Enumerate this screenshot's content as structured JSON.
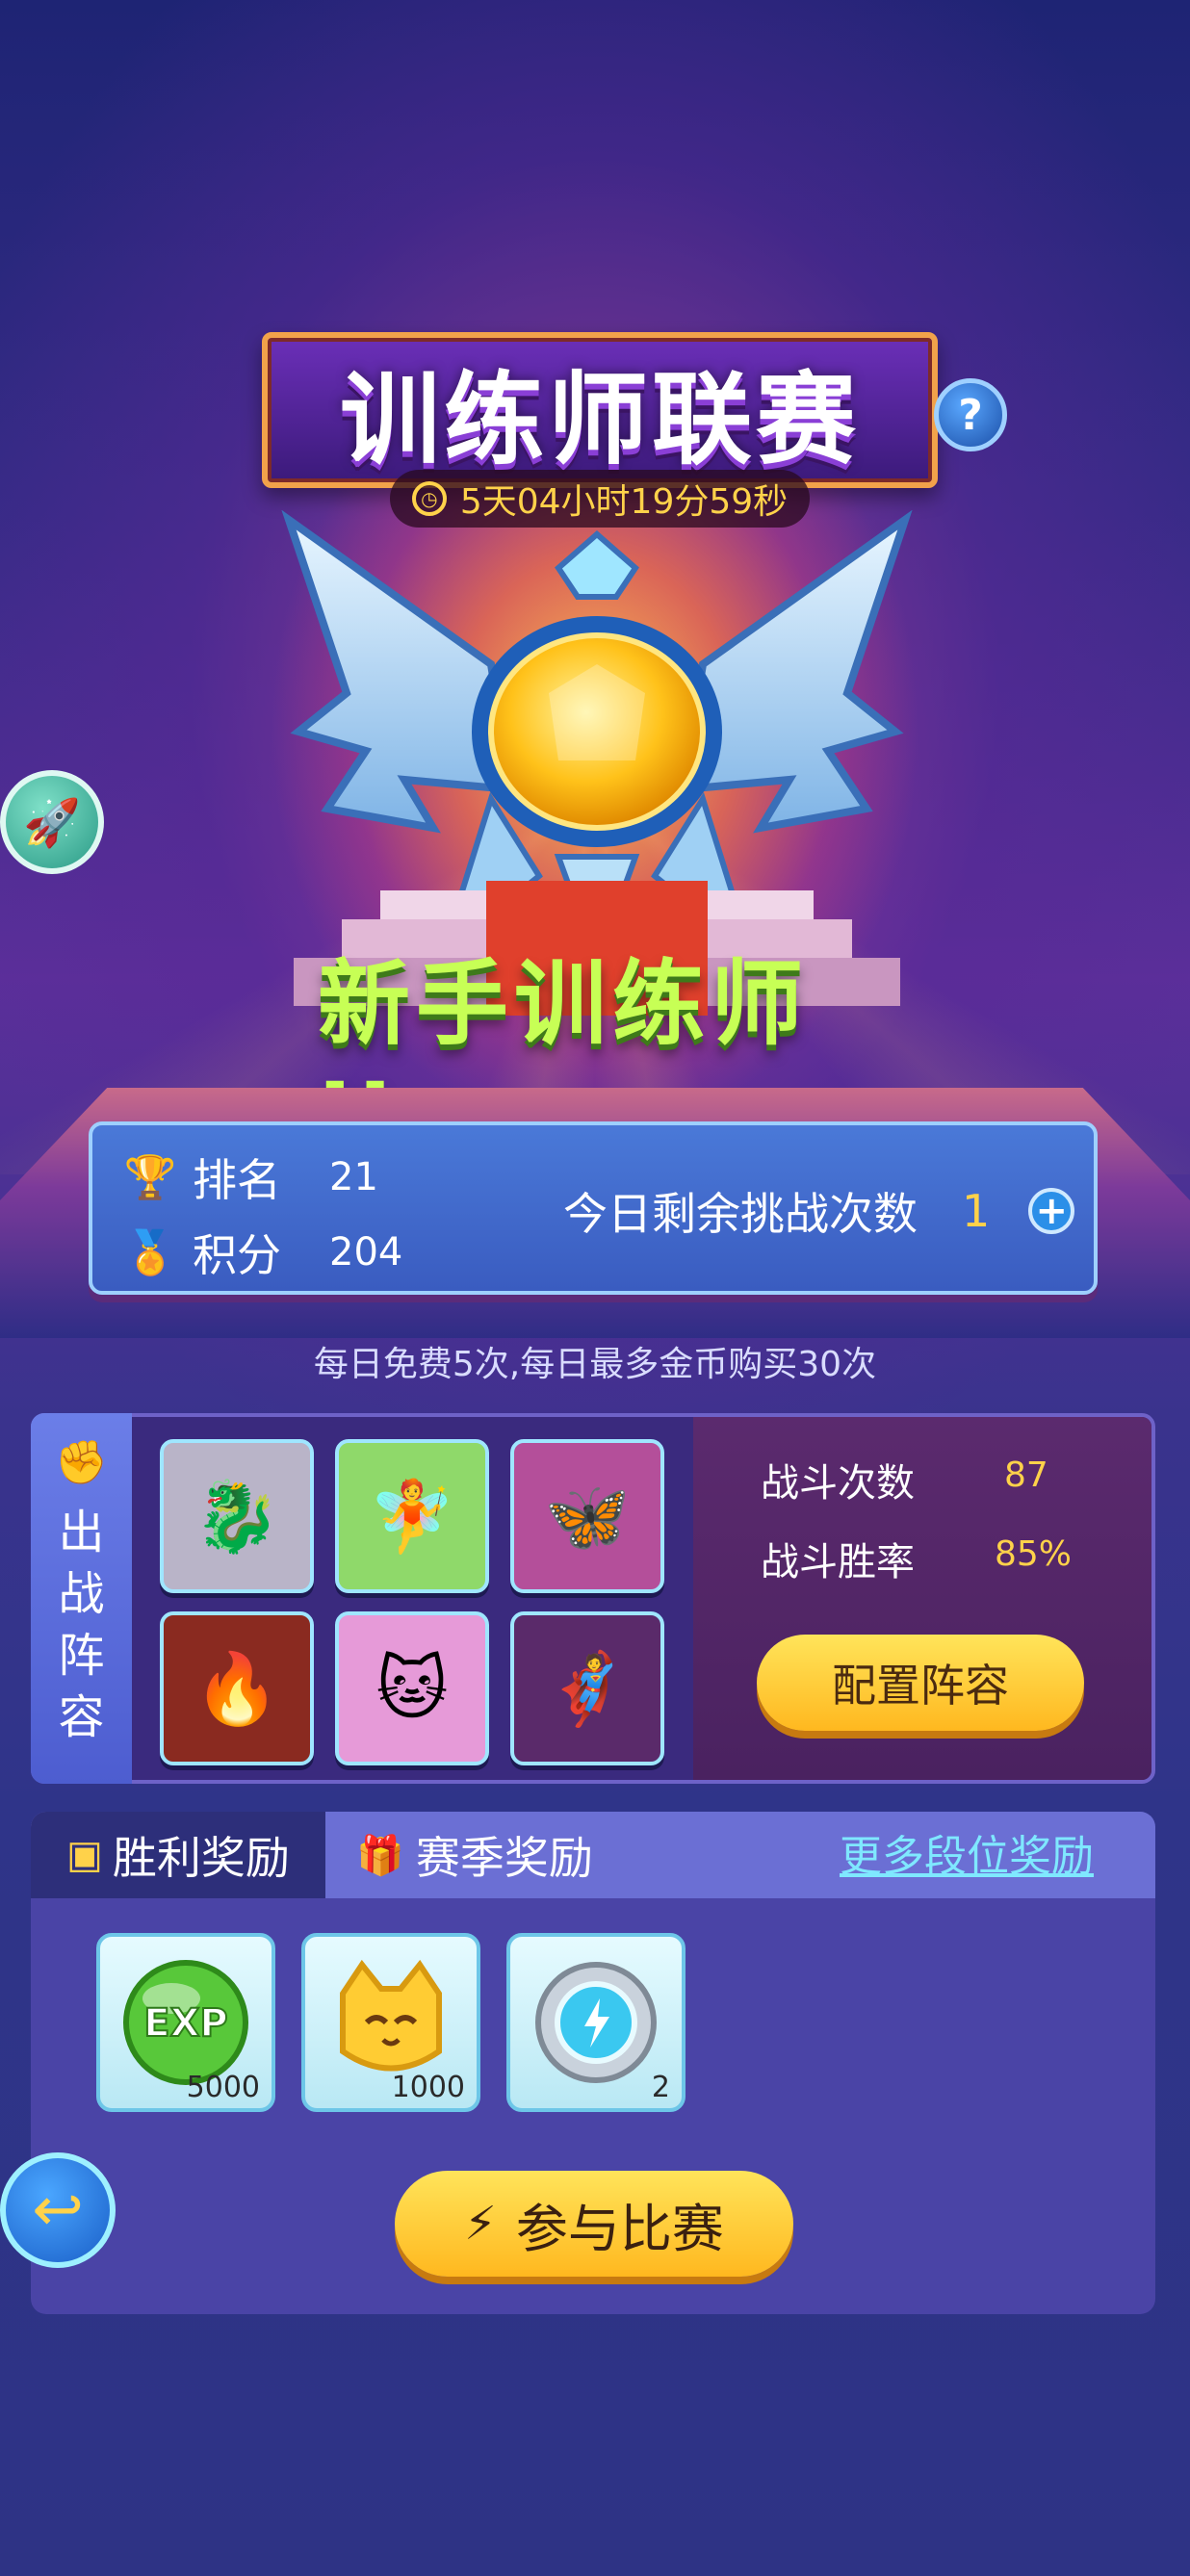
{
  "header": {
    "title": "训练师联赛",
    "timer": "5天04小时19分59秒",
    "help_label": "?"
  },
  "rank": {
    "name": "新手训练师 II"
  },
  "stats": {
    "rank_label": "排名",
    "rank_value": "21",
    "score_label": "积分",
    "score_value": "204",
    "remaining_label": "今日剩余挑战次数",
    "remaining_value": "1",
    "plus_label": "+",
    "note": "每日免费5次,每日最多金币购买30次"
  },
  "lineup": {
    "label_chars": [
      "出",
      "战",
      "阵",
      "容"
    ],
    "heroes": [
      {
        "icon": "dragon-knight-icon",
        "glyph": "🐉",
        "bg": "#b9b4c8"
      },
      {
        "icon": "flower-girl-icon",
        "glyph": "🧚",
        "bg": "#8fd96a"
      },
      {
        "icon": "armored-fairy-icon",
        "glyph": "🦋",
        "bg": "#b44f9a"
      },
      {
        "icon": "fire-dragon-icon",
        "glyph": "🔥",
        "bg": "#8a2a20"
      },
      {
        "icon": "pink-cat-icon",
        "glyph": "🐱",
        "bg": "#e69ad8"
      },
      {
        "icon": "masked-hero-icon",
        "glyph": "🦸",
        "bg": "#5a2a6a"
      }
    ],
    "battle_count_label": "战斗次数",
    "battle_count_value": "87",
    "win_rate_label": "战斗胜率",
    "win_rate_value": "85%",
    "config_button": "配置阵容"
  },
  "rewards": {
    "tab_victory": "胜利奖励",
    "tab_season": "赛季奖励",
    "more_link": "更多段位奖励",
    "items": [
      {
        "icon": "exp-orb-icon",
        "qty": "5000"
      },
      {
        "icon": "cat-coin-icon",
        "qty": "1000"
      },
      {
        "icon": "energy-badge-icon",
        "qty": "2"
      }
    ],
    "join_button": "参与比赛"
  },
  "colors": {
    "accent_gold": "#ffd24a",
    "panel_blue": "#4a79d8",
    "link_cyan": "#7fe8ff"
  }
}
